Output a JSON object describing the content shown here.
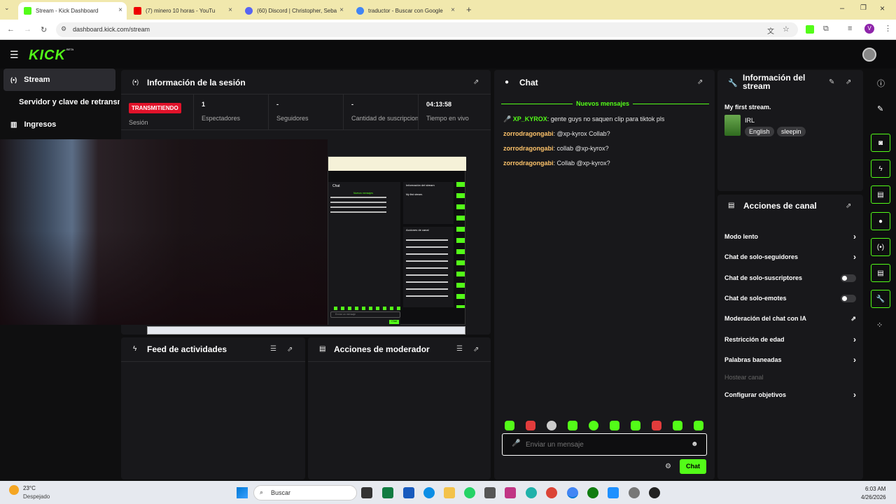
{
  "browser": {
    "tabs": [
      {
        "title": "Stream - Kick Dashboard",
        "active": true
      },
      {
        "title": "(7) minero 10 horas - YouTu"
      },
      {
        "title": "(60) Discord | Christopher, Seba"
      },
      {
        "title": "traductor - Buscar con Google"
      }
    ],
    "url": "dashboard.kick.com/stream",
    "profile_initial": "V"
  },
  "app": {
    "logo": "KICK",
    "beta": "BETA"
  },
  "sidebar": {
    "items": [
      {
        "label": "Stream",
        "icon": "broadcast-icon"
      },
      {
        "label": "Servidor y clave de retransmisión"
      },
      {
        "label": "Ingresos",
        "icon": "chart-icon"
      }
    ]
  },
  "session": {
    "title": "Información de la sesión",
    "live_badge": "TRANSMITIENDO",
    "session_label": "Sesión",
    "stats": [
      {
        "value": "1",
        "label": "Espectadores"
      },
      {
        "value": "-",
        "label": "Seguidores"
      },
      {
        "value": "-",
        "label": "Cantidad de suscripciones"
      },
      {
        "value": "04:13:58",
        "label": "Tiempo en vivo"
      }
    ]
  },
  "preview": {
    "chat_title": "Chat",
    "new_msgs": "Nuevos mensajes",
    "info_title": "Información del stream",
    "stream_title": "My first stream.",
    "actions_title": "Acciones de canal",
    "input_placeholder": "Enviar un mensaje",
    "chat_button": "Chat"
  },
  "activity_feed": {
    "title": "Feed de actividades"
  },
  "mod_actions": {
    "title": "Acciones de moderador"
  },
  "chat": {
    "title": "Chat",
    "new_messages": "Nuevos mensajes",
    "messages": [
      {
        "user": "XP_KYROX",
        "text": "gente guys no saquen clip para tiktok pls",
        "user_color": "#53fc18"
      },
      {
        "user": "zorrodragongabi",
        "text": "@xp-kyrox Collab?",
        "user_color": "#ffc46b"
      },
      {
        "user": "zorrodragongabi",
        "text": "collab @xp-kyrox?",
        "user_color": "#ffc46b"
      },
      {
        "user": "zorrodragongabi",
        "text": "Collab @xp-kyrox?",
        "user_color": "#ffc46b"
      }
    ],
    "input_placeholder": "Enviar un mensaje",
    "send_button": "Chat"
  },
  "stream_info": {
    "title": "Información del stream",
    "stream_title": "My first stream.",
    "category": "IRL",
    "tags": [
      "English",
      "sleepin"
    ]
  },
  "channel_actions": {
    "title": "Acciones de canal",
    "items": [
      {
        "label": "Modo lento",
        "control": "chevron"
      },
      {
        "label": "Chat de solo-seguidores",
        "control": "chevron"
      },
      {
        "label": "Chat de solo-suscriptores",
        "control": "toggle"
      },
      {
        "label": "Chat de solo-emotes",
        "control": "toggle"
      },
      {
        "label": "Moderación del chat con IA",
        "control": "external"
      },
      {
        "label": "Restricción de edad",
        "control": "chevron"
      },
      {
        "label": "Palabras baneadas",
        "control": "chevron"
      },
      {
        "label": "Hostear canal",
        "control": "disabled"
      },
      {
        "label": "Configurar objetivos",
        "control": "chevron"
      }
    ]
  },
  "taskbar": {
    "weather_temp": "23°C",
    "weather_desc": "Despejado",
    "search_placeholder": "Buscar",
    "time": "6:03 AM",
    "date": "4/26/2026"
  },
  "colors": {
    "accent": "#53fc18",
    "live": "#e1122a",
    "panel": "#18181b",
    "bg": "#0f0f10"
  }
}
